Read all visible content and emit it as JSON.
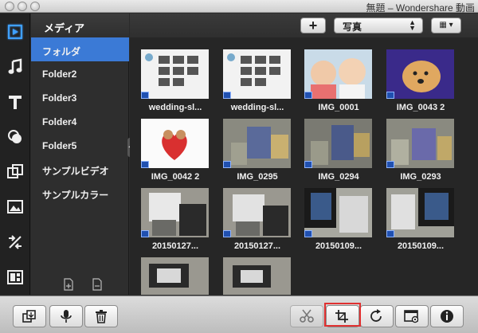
{
  "window": {
    "title": "無題 – Wondershare 動画"
  },
  "media_panel": {
    "header": "メディア"
  },
  "folders": [
    {
      "label": "フォルダ"
    },
    {
      "label": "Folder2"
    },
    {
      "label": "Folder3"
    },
    {
      "label": "Folder4"
    },
    {
      "label": "Folder5"
    },
    {
      "label": "サンプルビデオ"
    },
    {
      "label": "サンプルカラー"
    }
  ],
  "toolbar": {
    "add_label": "+",
    "filter_value": "写真",
    "view_label": "▦ ▾"
  },
  "media_items": [
    {
      "label": "wedding-sl..."
    },
    {
      "label": "wedding-sl..."
    },
    {
      "label": "IMG_0001"
    },
    {
      "label": "IMG_0043 2"
    },
    {
      "label": "IMG_0042 2"
    },
    {
      "label": "IMG_0295"
    },
    {
      "label": "IMG_0294"
    },
    {
      "label": "IMG_0293"
    },
    {
      "label": "20150127..."
    },
    {
      "label": "20150127..."
    },
    {
      "label": "20150109..."
    },
    {
      "label": "20150109..."
    },
    {
      "label": ""
    },
    {
      "label": ""
    }
  ],
  "icons": {
    "rail": [
      "media-icon",
      "music-icon",
      "text-icon",
      "filter-icon",
      "overlay-icon",
      "picture-in-picture-icon",
      "transition-icon",
      "layout-icon"
    ],
    "bottom": [
      "import-icon",
      "microphone-icon",
      "trash-icon",
      "cut-icon",
      "crop-icon",
      "rotate-icon",
      "settings-icon",
      "info-icon"
    ]
  },
  "colors": {
    "selection": "#3b7ad6",
    "highlight": "#e03030"
  }
}
